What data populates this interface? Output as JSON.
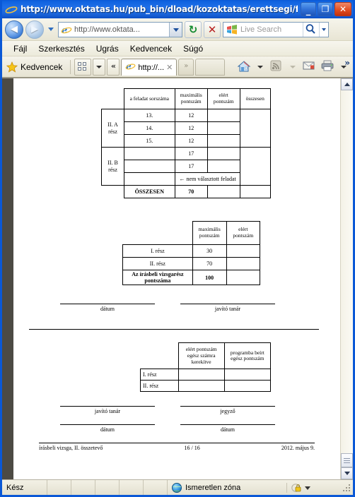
{
  "window": {
    "title": "http://www.oktatas.hu/pub_bin/dload/kozoktatas/erettsegi/fe...",
    "minimize_label": "_",
    "maximize_label": "❐",
    "close_label": "✕",
    "ie_icon": "internet-explorer-icon"
  },
  "nav": {
    "back_label": "◀",
    "forward_label": "▶",
    "history_dropdown": "history-dropdown-icon",
    "address_value": "http://www.oktata...",
    "address_dropdown": "chevron-down-icon",
    "refresh_label": "↻",
    "stop_label": "✕",
    "search_placeholder": "Live Search",
    "search_go": "search-icon",
    "search_dropdown": "chevron-down-icon"
  },
  "menu": {
    "items": [
      {
        "label": "Fájl"
      },
      {
        "label": "Szerkesztés"
      },
      {
        "label": "Ugrás"
      },
      {
        "label": "Kedvencek"
      },
      {
        "label": "Súgó"
      }
    ]
  },
  "favbar": {
    "favorites_label": "Kedvencek",
    "star_icon": "star-icon",
    "quicktabs_icon": "quick-tabs-icon",
    "quicktabs_dropdown": "chevron-down-icon",
    "tablist_prev": "«",
    "tab_title": "http://...",
    "tab_close": "✕",
    "tablist_next": "»",
    "home_icon": "home-icon",
    "feeds_icon": "rss-feed-icon",
    "mail_icon": "mail-icon",
    "print_icon": "printer-icon",
    "overflow_label": "»"
  },
  "document": {
    "table1": {
      "headers": [
        "",
        "a feladat sorszáma",
        "maximális pontszám",
        "elért pontszám",
        "összesen"
      ],
      "group_a": "II. A rész",
      "group_b": "II. B rész",
      "rows_a": [
        {
          "no": "13.",
          "max": "12"
        },
        {
          "no": "14.",
          "max": "12"
        },
        {
          "no": "15.",
          "max": "12"
        }
      ],
      "rows_b": [
        {
          "no": "",
          "max": "17"
        },
        {
          "no": "",
          "max": "17"
        }
      ],
      "note": "← nem választott feladat",
      "total_label": "ÖSSZESEN",
      "total_value": "70"
    },
    "table2": {
      "headers": [
        "",
        "maximális pontszám",
        "elért pontszám"
      ],
      "rows": [
        {
          "label": "I. rész",
          "max": "30",
          "scored": ""
        },
        {
          "label": "II. rész",
          "max": "70",
          "scored": ""
        },
        {
          "label": "Az írásbeli vizsgarész pontszáma",
          "max": "100",
          "scored": ""
        }
      ]
    },
    "signatures1": [
      {
        "caption": "dátum"
      },
      {
        "caption": "javító tanár"
      }
    ],
    "table3": {
      "headers": [
        "",
        "elért pontszám egész számra kerekítve",
        "programba beírt egész pontszám"
      ],
      "rows": [
        {
          "label": "I. rész",
          "rounded": "",
          "entered": ""
        },
        {
          "label": "II. rész",
          "rounded": "",
          "entered": ""
        }
      ]
    },
    "signatures2": [
      {
        "caption": "javító tanár"
      },
      {
        "caption": "jegyző"
      }
    ],
    "signatures3": [
      {
        "caption": "dátum"
      },
      {
        "caption": "dátum"
      }
    ],
    "footer": {
      "left": "írásbeli vizsga, II. összetevő",
      "center": "16 / 16",
      "right": "2012. május 9."
    }
  },
  "statusbar": {
    "status": "Kész",
    "zone_label": "Ismeretlen zóna",
    "zone_icon": "globe-icon",
    "security_icon": "lock-icon",
    "security_dropdown": "chevron-down-icon",
    "resizer": "resize-grip"
  }
}
